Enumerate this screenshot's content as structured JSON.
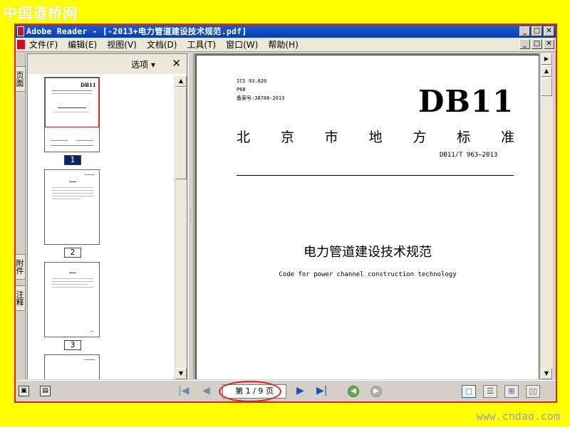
{
  "watermarks": {
    "top": "中国道桥网",
    "bottom": "www.cndao.com"
  },
  "window": {
    "title": "Adobe Reader - [-2013+电力管道建设技术规范.pdf]",
    "controls": {
      "minimize": "_",
      "restore": "□",
      "close": "✕"
    }
  },
  "menu": [
    "文件(F)",
    "编辑(E)",
    "视图(V)",
    "文档(D)",
    "工具(T)",
    "窗口(W)",
    "帮助(H)"
  ],
  "nav_tabs": {
    "pages": "页面",
    "attachments": "附件",
    "comments": "注释"
  },
  "panel": {
    "options": "选项 ▾",
    "close": "✕"
  },
  "thumbnails": [
    "1",
    "2",
    "3"
  ],
  "document": {
    "ics": "ICS 93.020",
    "p_code": "P60",
    "record_no": "备案号:38788-2013",
    "db": "DB11",
    "standard_kind": [
      "北",
      "京",
      "市",
      "地",
      "方",
      "标",
      "准"
    ],
    "standard_code": "DB11/T 963—2013",
    "title_cn": "电力管道建设技术规范",
    "title_en": "Code for power channel construction technology"
  },
  "status": {
    "page_field": "第 1 / 9 页",
    "first": "|◀",
    "prev": "◀",
    "next": "▶",
    "last": "▶|",
    "back": "◀",
    "forward": "▶"
  }
}
